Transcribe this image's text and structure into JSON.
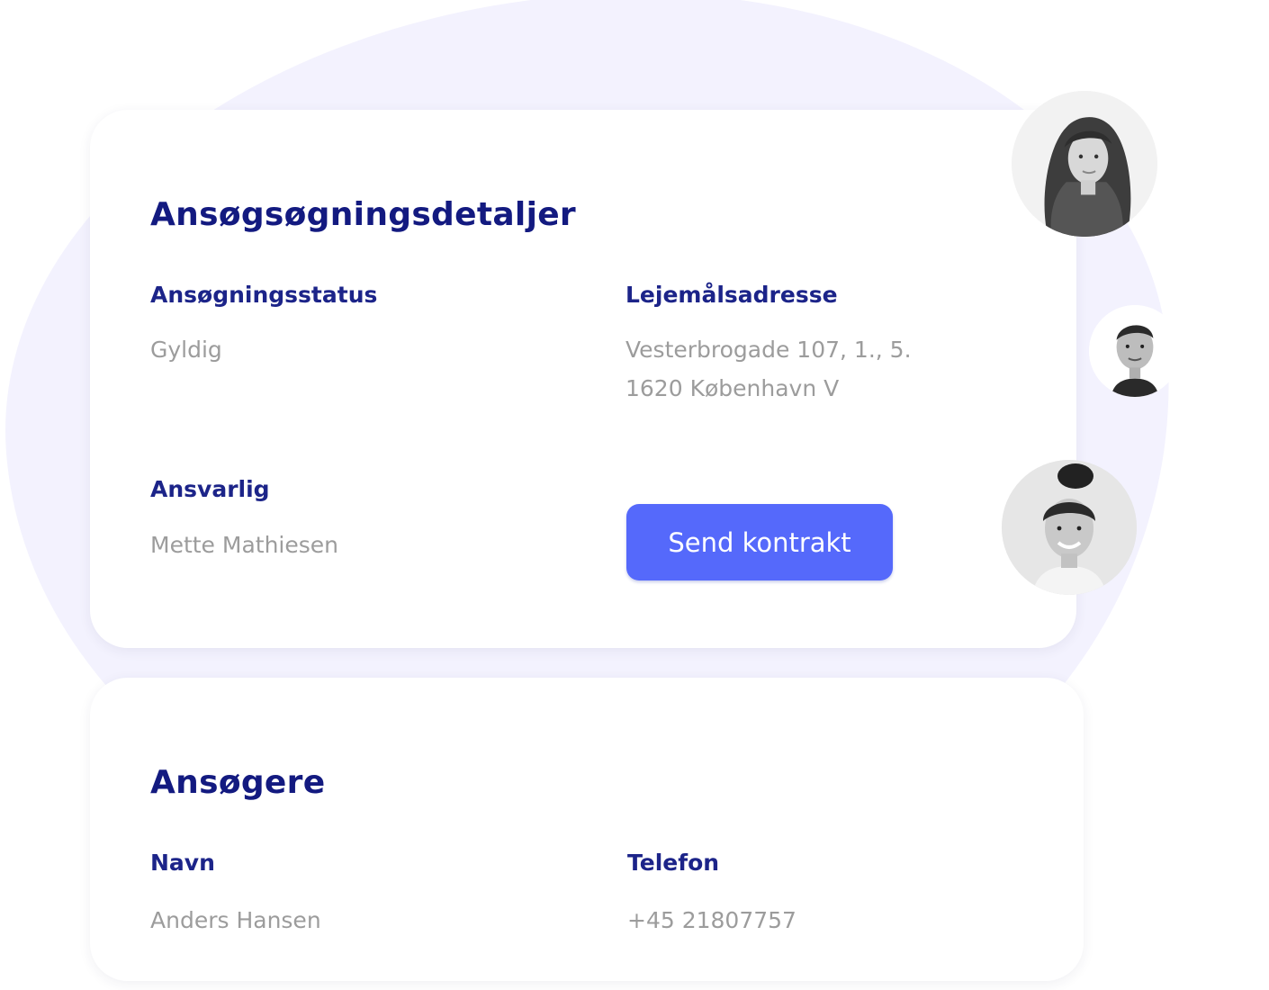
{
  "details": {
    "title": "Ansøgsøgningsdetaljer",
    "status_label": "Ansøgningsstatus",
    "status_value": "Gyldig",
    "address_label": "Lejemålsadresse",
    "address_line1": "Vesterbrogade 107, 1., 5.",
    "address_line2": "1620 København V",
    "responsible_label": "Ansvarlig",
    "responsible_value": "Mette Mathiesen",
    "send_button": "Send kontrakt"
  },
  "applicants": {
    "title": "Ansøgere",
    "name_label": "Navn",
    "name_value": "Anders Hansen",
    "phone_label": "Telefon",
    "phone_value": "+45 21807757"
  },
  "avatars": [
    "avatar-woman-long-hair",
    "avatar-man",
    "avatar-woman-bun"
  ],
  "colors": {
    "heading": "#131a80",
    "label": "#1c2489",
    "value": "#9c9c9c",
    "button": "#5569fb",
    "blob": "#f3f2fe"
  }
}
